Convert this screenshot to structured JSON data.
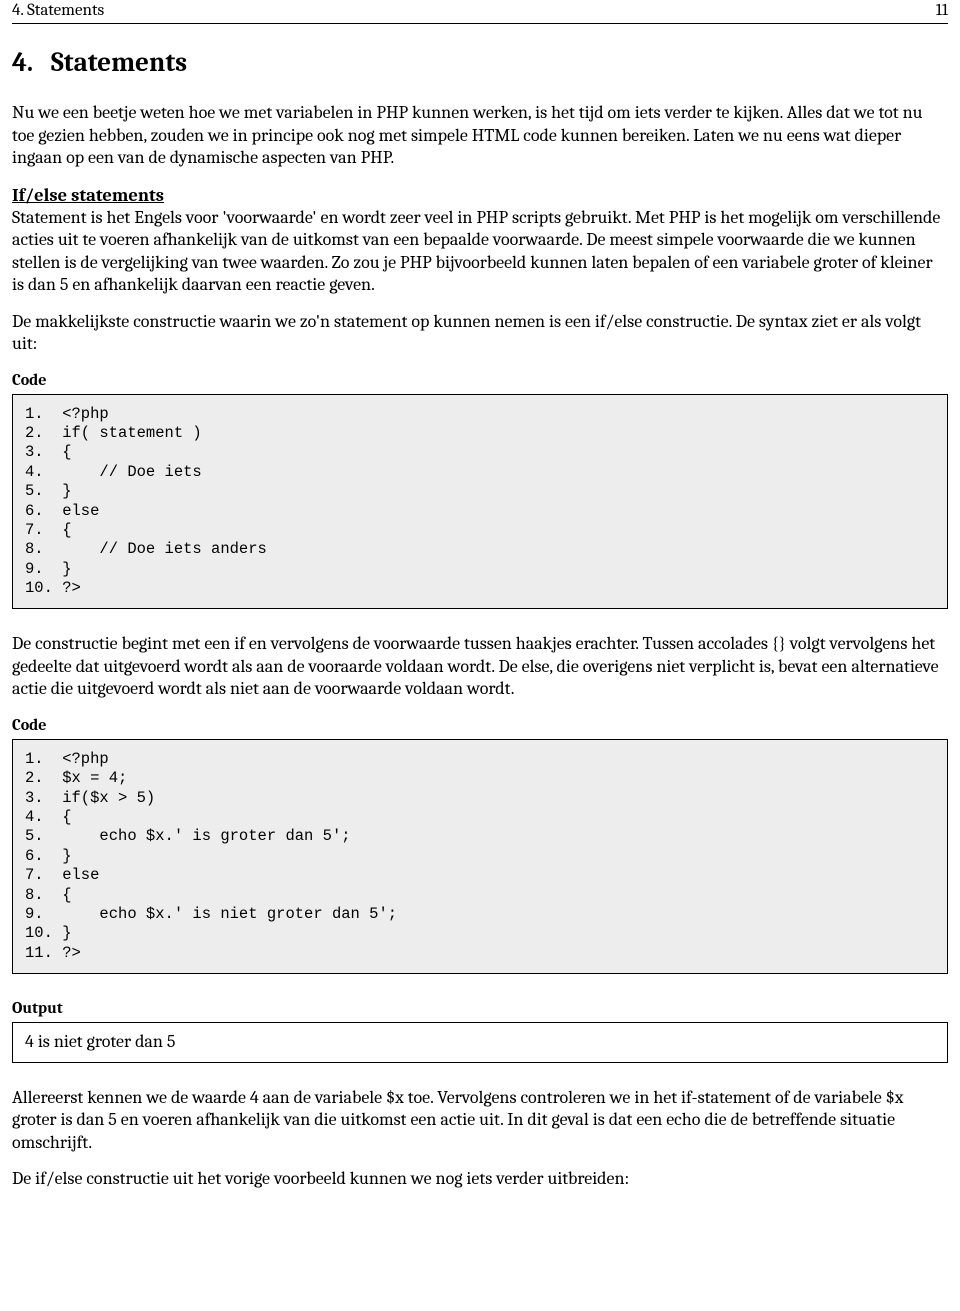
{
  "header": {
    "running_title": "4. Statements",
    "page_number": "11"
  },
  "section": {
    "number": "4.",
    "title": "Statements"
  },
  "intro_para": "Nu we een beetje weten hoe we met variabelen in PHP kunnen werken, is het tijd om iets verder te kijken. Alles dat we tot nu toe gezien hebben, zouden we in principe ook nog met simpele HTML code kunnen bereiken. Laten we nu eens wat dieper ingaan op een van de dynamische aspecten van PHP.",
  "ifelse_heading": "If/else statements",
  "ifelse_para1": "Statement is het Engels voor 'voorwaarde' en wordt zeer veel in PHP scripts gebruikt. Met PHP is het mogelijk om verschillende acties uit te voeren afhankelijk van de uitkomst van een bepaalde voorwaarde. De meest simpele voorwaarde die we kunnen stellen is de vergelijking van twee waarden. Zo zou je PHP bijvoorbeeld kunnen laten bepalen of een variabele groter of kleiner is dan 5 en afhankelijk daarvan een reactie geven.",
  "ifelse_para2": "De makkelijkste constructie waarin we zo'n statement op kunnen nemen is een if/else constructie. De syntax ziet er als volgt uit:",
  "label_code": "Code",
  "label_output": "Output",
  "code_block_1": "1.  <?php\n2.  if( statement )\n3.  {\n4.      // Doe iets\n5.  }\n6.  else\n7.  {\n8.      // Doe iets anders\n9.  }\n10. ?>",
  "para_after_code1": "De constructie begint met een if en vervolgens de voorwaarde tussen haakjes erachter. Tussen accolades {} volgt vervolgens het gedeelte dat uitgevoerd wordt als aan de vooraarde voldaan wordt. De else, die overigens niet verplicht is, bevat een alternatieve actie die uitgevoerd wordt als niet aan de voorwaarde voldaan wordt.",
  "code_block_2": "1.  <?php\n2.  $x = 4;\n3.  if($x > 5)\n4.  {\n5.      echo $x.' is groter dan 5';\n6.  }\n7.  else\n8.  {\n9.      echo $x.' is niet groter dan 5';\n10. }\n11. ?>",
  "output_block_1": "4 is niet groter dan 5",
  "para_after_output1": "Allereerst kennen we de waarde 4 aan de variabele $x toe. Vervolgens controleren we in het if-statement of de variabele $x groter is dan 5 en voeren afhankelijk van die uitkomst een actie uit. In dit geval is dat een echo die de betreffende situatie omschrijft.",
  "para_last": "De if/else constructie uit het vorige voorbeeld kunnen we nog iets verder uitbreiden:"
}
